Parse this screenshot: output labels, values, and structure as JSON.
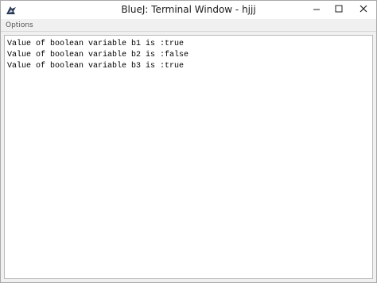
{
  "window": {
    "title": "BlueJ: Terminal Window - hjjj"
  },
  "menu": {
    "options_label": "Options"
  },
  "terminal": {
    "lines": [
      "Value of boolean variable b1 is :true",
      "Value of boolean variable b2 is :false",
      "Value of boolean variable b3 is :true"
    ]
  },
  "icons": {
    "app": "bluej-bird-icon",
    "minimize": "minimize-icon",
    "maximize": "maximize-icon",
    "close": "close-icon"
  }
}
